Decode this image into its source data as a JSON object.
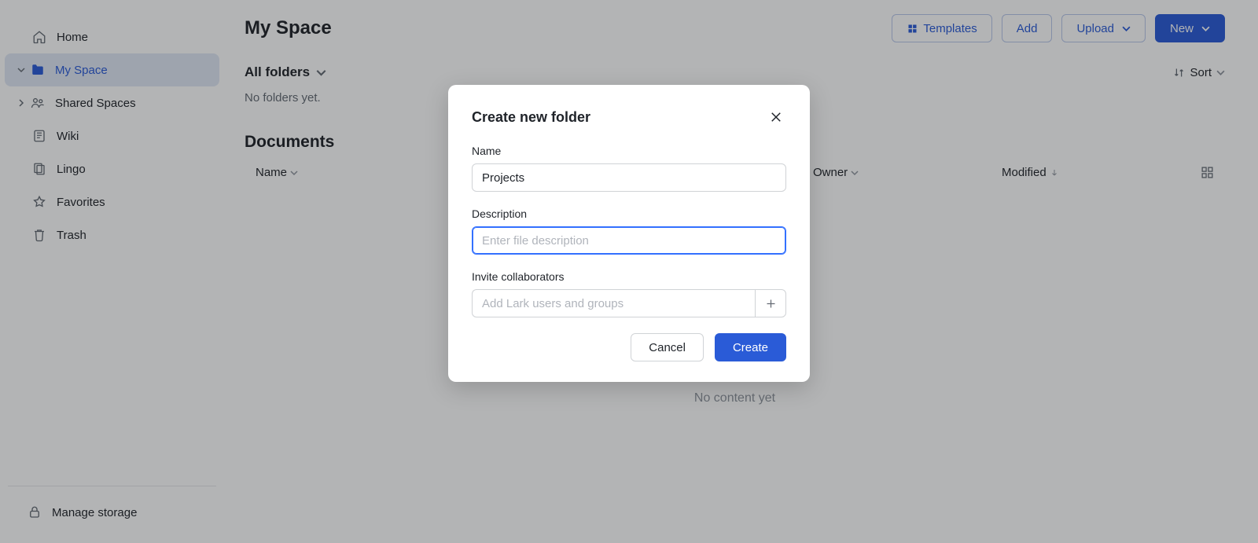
{
  "sidebar": {
    "items": [
      {
        "label": "Home"
      },
      {
        "label": "My Space"
      },
      {
        "label": "Shared Spaces"
      },
      {
        "label": "Wiki"
      },
      {
        "label": "Lingo"
      },
      {
        "label": "Favorites"
      },
      {
        "label": "Trash"
      }
    ],
    "footer_label": "Manage storage"
  },
  "main": {
    "page_title": "My Space",
    "actions": {
      "templates_label": "Templates",
      "add_label": "Add",
      "upload_label": "Upload",
      "new_label": "New"
    },
    "folders": {
      "header_label": "All folders",
      "empty_text": "No folders yet."
    },
    "sort_label": "Sort",
    "documents": {
      "heading": "Documents",
      "col_name": "Name",
      "col_owner": "Owner",
      "col_modified": "Modified",
      "empty_text": "No content yet"
    }
  },
  "modal": {
    "title": "Create new folder",
    "fields": {
      "name_label": "Name",
      "name_value": "Projects",
      "description_label": "Description",
      "description_placeholder": "Enter file description",
      "collaborators_label": "Invite collaborators",
      "collaborators_placeholder": "Add Lark users and groups"
    },
    "buttons": {
      "cancel": "Cancel",
      "create": "Create"
    }
  }
}
